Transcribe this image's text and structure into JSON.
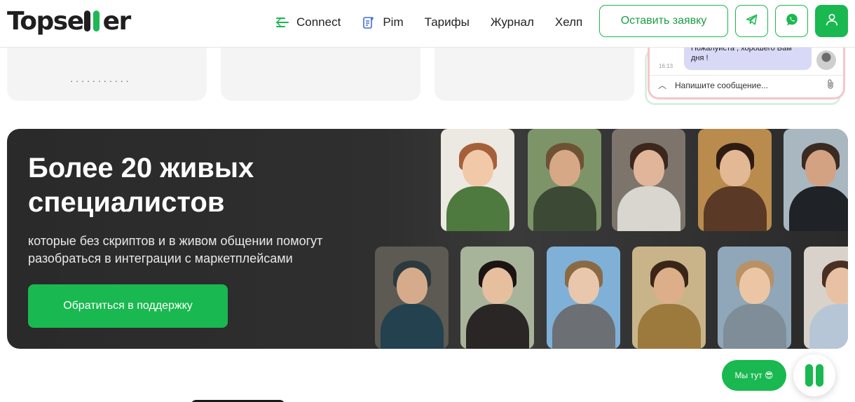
{
  "header": {
    "logo": {
      "part1": "Topse",
      "part2": "er"
    },
    "nav": [
      {
        "label": "Connect",
        "icon": "connect-lines-icon"
      },
      {
        "label": "Pim",
        "icon": "pim-doc-icon"
      },
      {
        "label": "Тарифы"
      },
      {
        "label": "Журнал"
      },
      {
        "label": "Хелп"
      }
    ],
    "order_button": "Оставить заявку",
    "telegram_icon": "telegram-icon",
    "whatsapp_icon": "whatsapp-icon",
    "user_icon": "user-icon"
  },
  "cards": [
    {
      "text": "· · · · · · · · · · ·"
    },
    {
      "text": ""
    },
    {
      "text": ""
    }
  ],
  "chat_preview": {
    "message": "Пожалуйста , хорошего Вам дня !",
    "time": "16:13",
    "input_placeholder": "Напишите сообщение..."
  },
  "banner": {
    "title": "Более 20 живых специалистов",
    "subtitle": "которые без скриптов и в живом общении помогут разобраться в интеграции с маркетплейсами",
    "button": "Обратиться в поддержку"
  },
  "widget": {
    "label": "Мы тут 😎"
  },
  "colors": {
    "accent": "#1ab850",
    "banner_bg": "#2d2d2d"
  }
}
